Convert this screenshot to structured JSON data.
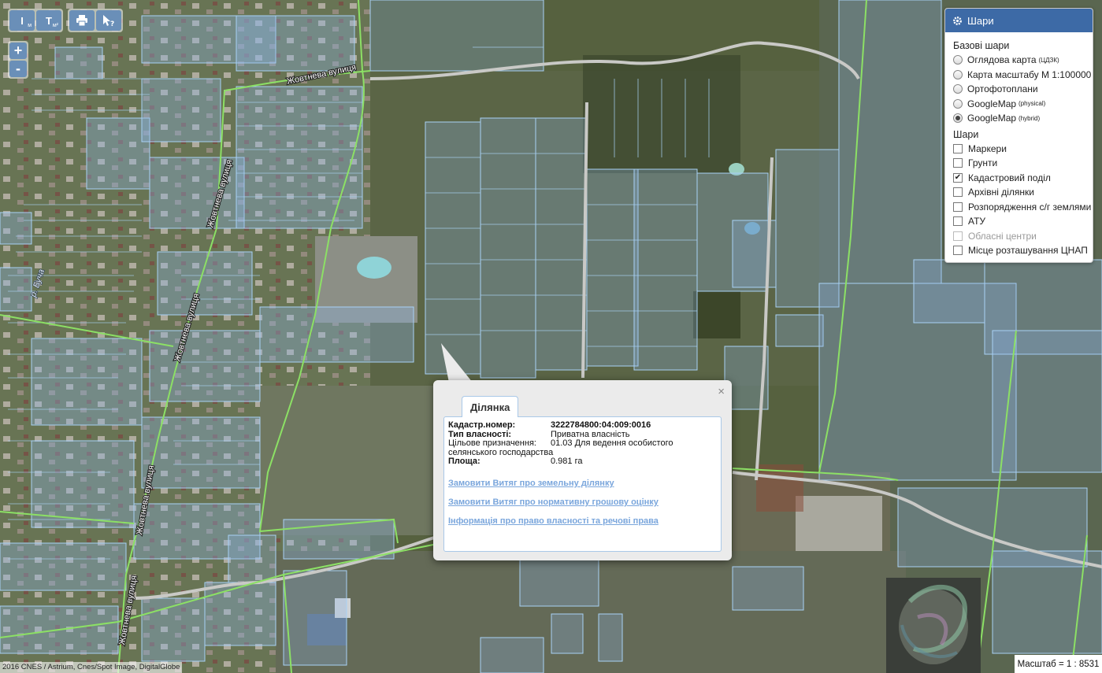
{
  "toolbar": {
    "measure_length": "I",
    "measure_length_unit": "м",
    "measure_area": "T",
    "measure_area_unit": "м²",
    "print_icon": "printer-icon",
    "identify_icon": "pointer-question-icon"
  },
  "zoom": {
    "in": "+",
    "out": "-"
  },
  "map_labels": {
    "street": "Жовтнева вулиця",
    "river": "р. Буча"
  },
  "layers": {
    "title": "Шари",
    "base_title": "Базові шари",
    "base": [
      {
        "label": "Оглядова карта",
        "sup": "(ЦДЗК)",
        "selected": false
      },
      {
        "label": "Карта масштабу М 1:100000",
        "sup": "",
        "selected": false
      },
      {
        "label": "Ортофотоплани",
        "sup": "",
        "selected": false
      },
      {
        "label": "GoogleMap",
        "sup": "(physical)",
        "selected": false
      },
      {
        "label": "GoogleMap",
        "sup": "(hybrid)",
        "selected": true
      }
    ],
    "overlay_title": "Шари",
    "overlays": [
      {
        "label": "Маркери",
        "checked": false
      },
      {
        "label": "Грунти",
        "checked": false
      },
      {
        "label": "Кадастровий поділ",
        "checked": true
      },
      {
        "label": "Архівні ділянки",
        "checked": false
      },
      {
        "label": "Розпорядження с/г землями",
        "checked": false
      },
      {
        "label": "АТУ",
        "checked": false
      },
      {
        "label": "Обласні центри",
        "checked": false,
        "disabled": true
      },
      {
        "label": "Місце розташування ЦНАП",
        "checked": false
      }
    ]
  },
  "popup": {
    "tab": "Ділянка",
    "close": "×",
    "fields": {
      "cadastral_label": "Кадастр.номер:",
      "cadastral_value": "3222784800:04:009:0016",
      "ownership_label": "Тип власності:",
      "ownership_value": "Приватна власність",
      "purpose_label": "Цільове призначення:",
      "purpose_value": "01.03 Для ведення особистого",
      "purpose_value_cont": "селянського господарства",
      "area_label": "Площа:",
      "area_value": "0.981 га"
    },
    "links": [
      "Замовити Витяг про земельну ділянку",
      "Замовити Витяг про нормативну грошову оцінку",
      "Інформація про право власності та речові права"
    ]
  },
  "scale": "Масштаб = 1 : 8531",
  "copyright": "2016 CNES / Astrium, Cnes/Spot Image, DigitalGlobe"
}
